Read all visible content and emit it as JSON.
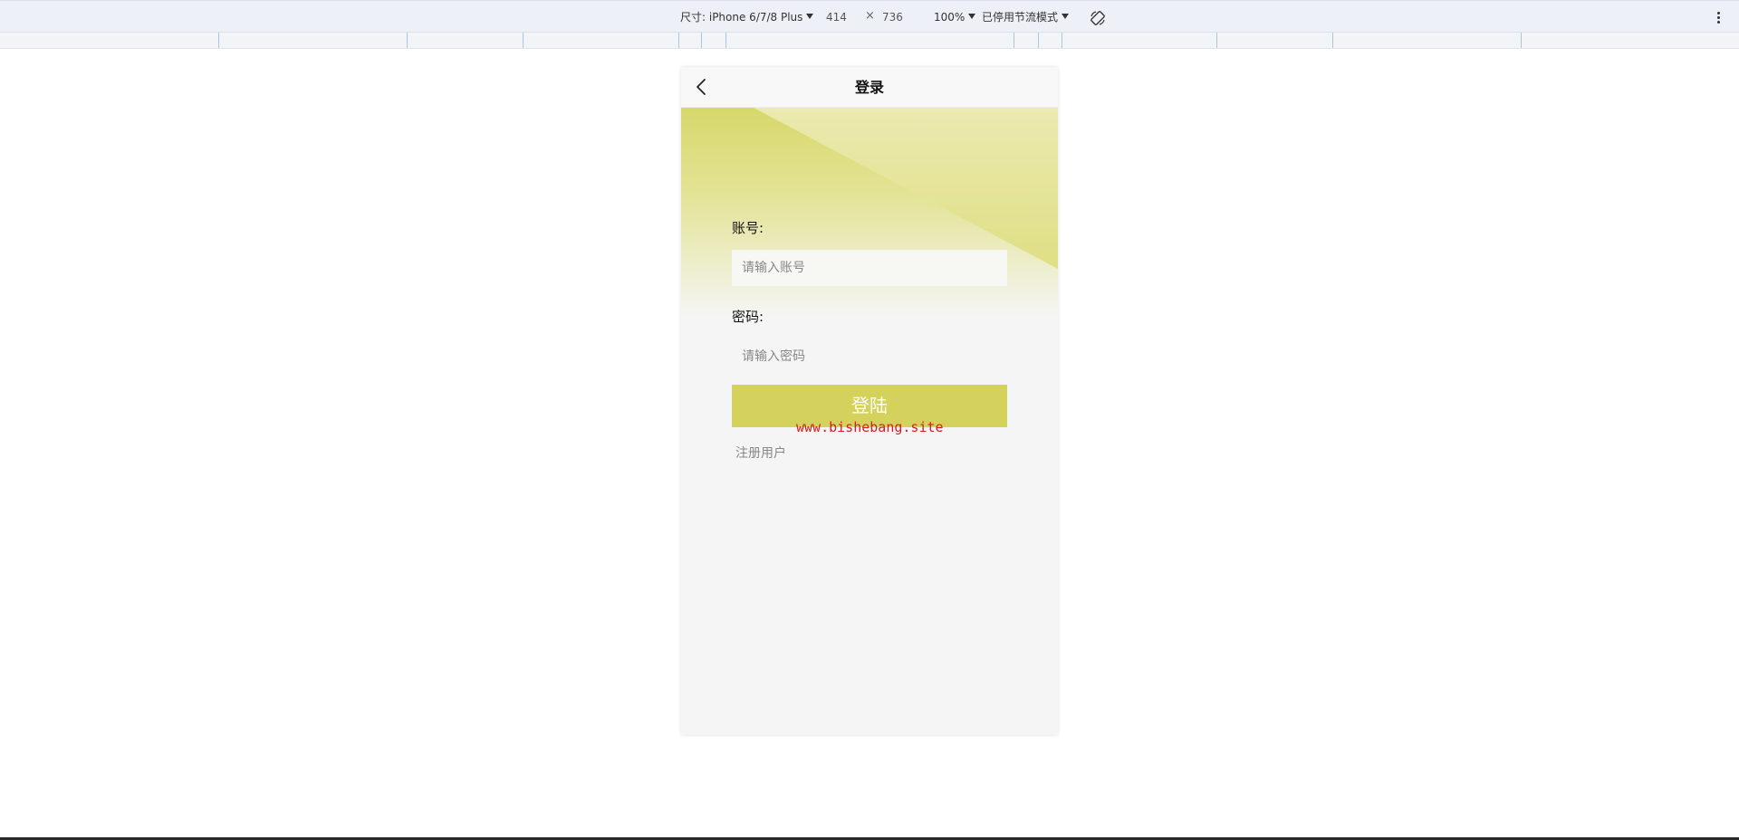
{
  "devtools": {
    "device_label": "尺寸: iPhone 6/7/8 Plus",
    "width": "414",
    "times": "×",
    "height": "736",
    "zoom": "100%",
    "throttle": "已停用节流模式",
    "icons": [
      "chevron-down-icon",
      "rotate-icon",
      "more-vertical-icon"
    ]
  },
  "app": {
    "nav_title": "登录",
    "account_label": "账号:",
    "account_placeholder": "请输入账号",
    "password_label": "密码:",
    "password_placeholder": "请输入密码",
    "login_button": "登陆",
    "register_link": "注册用户",
    "watermark": "www.bishebang.site",
    "colors": {
      "accent": "#d4d25c",
      "page_bg": "#f5f5f5",
      "watermark": "#d42020"
    }
  }
}
